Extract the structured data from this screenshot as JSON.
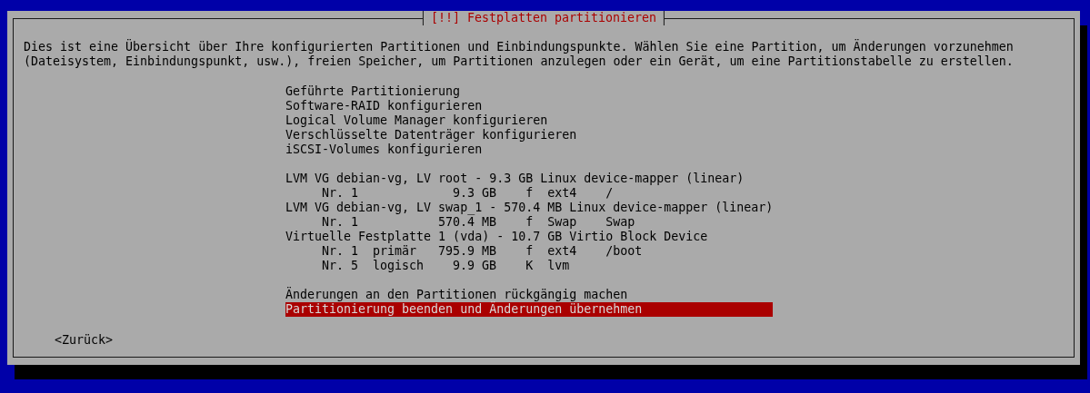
{
  "dialog": {
    "title": "[!!] Festplatten partitionieren",
    "description": [
      "Dies ist eine Übersicht über Ihre konfigurierten Partitionen und Einbindungspunkte. Wählen Sie eine Partition, um Änderungen vorzunehmen",
      "(Dateisystem, Einbindungspunkt, usw.), freien Speicher, um Partitionen anzulegen oder ein Gerät, um eine Partitionstabelle zu erstellen."
    ],
    "sections": [
      {
        "items": [
          {
            "kind": "action",
            "label": "Geführte Partitionierung",
            "selected": false
          },
          {
            "kind": "action",
            "label": "Software-RAID konfigurieren",
            "selected": false
          },
          {
            "kind": "action",
            "label": "Logical Volume Manager konfigurieren",
            "selected": false
          },
          {
            "kind": "action",
            "label": "Verschlüsselte Datenträger konfigurieren",
            "selected": false
          },
          {
            "kind": "action",
            "label": "iSCSI-Volumes konfigurieren",
            "selected": false
          }
        ]
      },
      {
        "items": [
          {
            "kind": "device",
            "label": "LVM VG debian-vg, LV root - 9.3 GB Linux device-mapper (linear)",
            "selected": false
          },
          {
            "kind": "partition",
            "number": "Nr. 1",
            "size": "9.3 GB",
            "flag": "f",
            "filesystem": "ext4",
            "mount": "/",
            "selected": false
          },
          {
            "kind": "device",
            "label": "LVM VG debian-vg, LV swap_1 - 570.4 MB Linux device-mapper (linear)",
            "selected": false
          },
          {
            "kind": "partition",
            "number": "Nr. 1",
            "size": "570.4 MB",
            "flag": "f",
            "filesystem": "Swap",
            "mount": "Swap",
            "selected": false
          },
          {
            "kind": "device",
            "label": "Virtuelle Festplatte 1 (vda) - 10.7 GB Virtio Block Device",
            "selected": false
          },
          {
            "kind": "partition",
            "number": "Nr. 1",
            "type": "primär",
            "size": "795.9 MB",
            "flag": "f",
            "filesystem": "ext4",
            "mount": "/boot",
            "selected": false
          },
          {
            "kind": "partition",
            "number": "Nr. 5",
            "type": "logisch",
            "size": "9.9 GB",
            "flag": "K",
            "filesystem": "lvm",
            "selected": false
          }
        ]
      },
      {
        "items": [
          {
            "kind": "action",
            "label": "Änderungen an den Partitionen rückgängig machen",
            "selected": false
          },
          {
            "kind": "action",
            "label": "Partitionierung beenden und Änderungen übernehmen",
            "selected": true
          }
        ]
      }
    ],
    "back_button": "<Zurück>"
  }
}
